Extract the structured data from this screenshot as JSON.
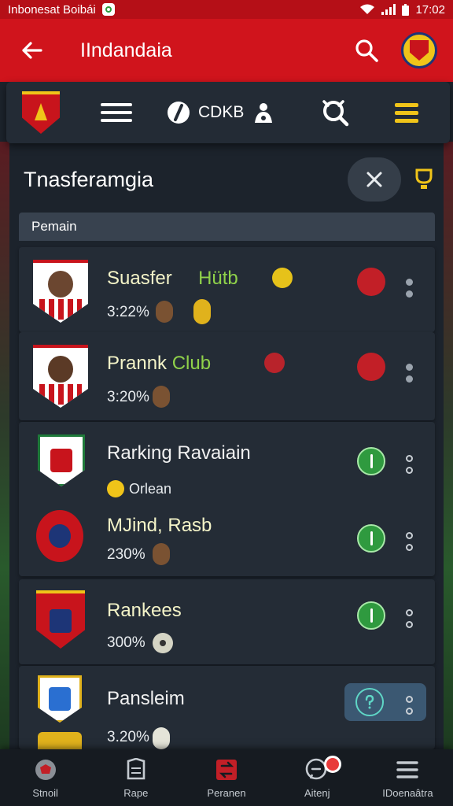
{
  "status_bar": {
    "left_text": "Inbonesat Boibái",
    "time": "17:02"
  },
  "app_bar": {
    "title": "IIndandaia"
  },
  "toolbar": {
    "group_label": "CDKB"
  },
  "section": {
    "title": "Tnasferamgia",
    "subheader": "Pemain"
  },
  "list": {
    "items": [
      {
        "name": "Suasfer",
        "club": "Hütb",
        "pct": "3:22%"
      },
      {
        "name": "Prannk",
        "club": "Club",
        "pct": "3:20%"
      },
      {
        "name": "Rarking Ravaiain",
        "sub": "Orlean"
      },
      {
        "name": "MJind, Rasb",
        "pct": "230%"
      },
      {
        "name": "Rankees",
        "pct": "300%"
      },
      {
        "name": "Pansleim",
        "pct": "3.20%"
      }
    ]
  },
  "bottom_nav": {
    "items": [
      {
        "label": "Stnoil"
      },
      {
        "label": "Rape"
      },
      {
        "label": "Peranen"
      },
      {
        "label": "Aitenj"
      },
      {
        "label": "IDoenaâtra"
      }
    ]
  },
  "colors": {
    "primary_red": "#d0141c",
    "card": "#242c36",
    "accent_yellow": "#f0c419",
    "accent_green": "#2f9a3f"
  }
}
